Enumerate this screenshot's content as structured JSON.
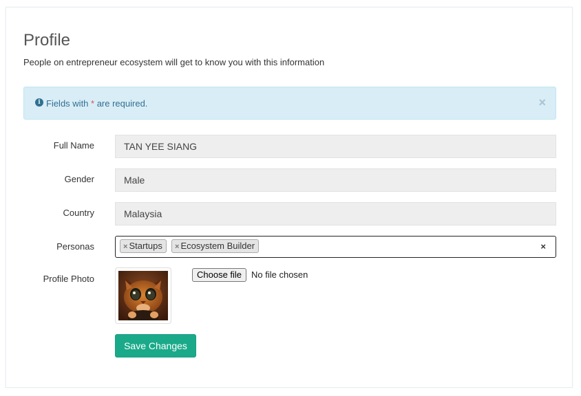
{
  "page": {
    "title": "Profile",
    "subtitle": "People on entrepreneur ecosystem will get to know you with this information"
  },
  "alert": {
    "text_before": "Fields with ",
    "star": "*",
    "text_after": " are required.",
    "icon": "info-circle-icon",
    "close_icon": "close-icon",
    "close_glyph": "×",
    "color_bg": "#d9edf7",
    "color_text": "#31708f"
  },
  "form": {
    "full_name": {
      "label": "Full Name",
      "value": "TAN YEE SIANG"
    },
    "gender": {
      "label": "Gender",
      "value": "Male"
    },
    "country": {
      "label": "Country",
      "value": "Malaysia"
    },
    "personas": {
      "label": "Personas",
      "tags": [
        "Startups",
        "Ecosystem Builder"
      ],
      "remove_glyph": "×",
      "clear_glyph": "×"
    },
    "profile_photo": {
      "label": "Profile Photo",
      "choose_label": "Choose file",
      "status": "No file chosen"
    },
    "save_label": "Save Changes"
  },
  "colors": {
    "primary_button": "#1aaa8a",
    "required_star": "#d9534f"
  }
}
